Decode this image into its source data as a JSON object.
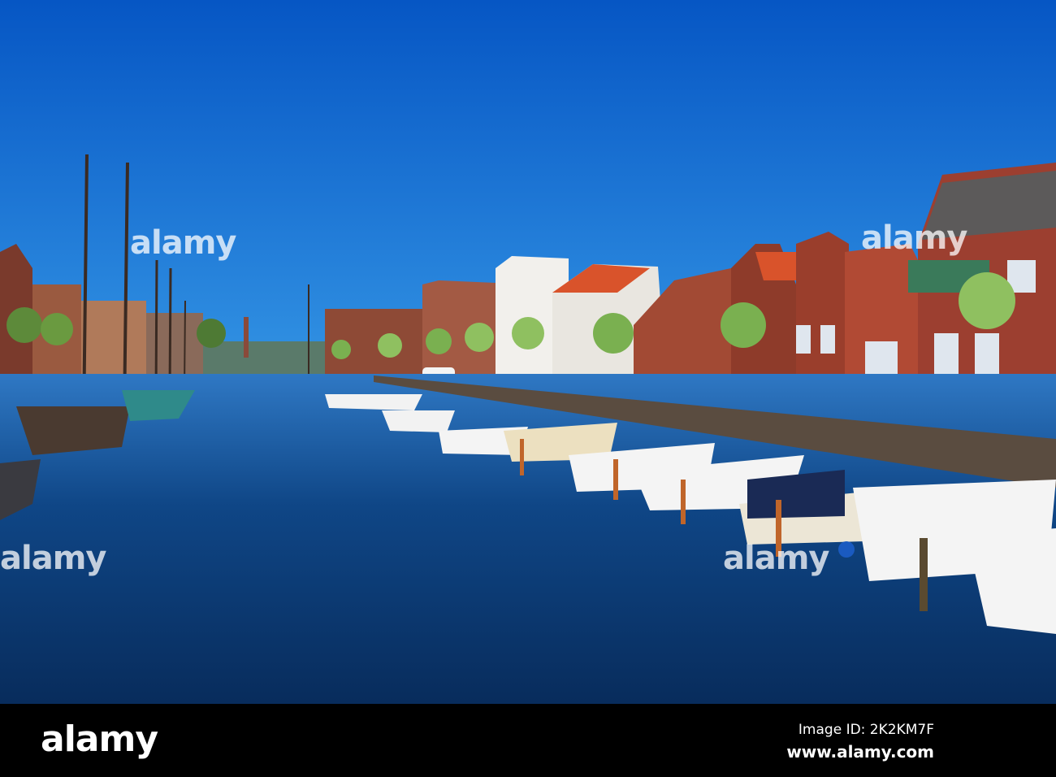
{
  "photo": {
    "subject": "canal",
    "colors": {
      "sky_top": "#0656c4",
      "sky_bottom": "#2d8de2",
      "water": "#0c3a78",
      "brick": "#8e3b2a",
      "roof": "#d9532b"
    }
  },
  "watermark": {
    "text": "alamy"
  },
  "footer": {
    "logo": "alamy",
    "image_id": "Image ID: 2K2KM7F",
    "website": "www.alamy.com"
  }
}
